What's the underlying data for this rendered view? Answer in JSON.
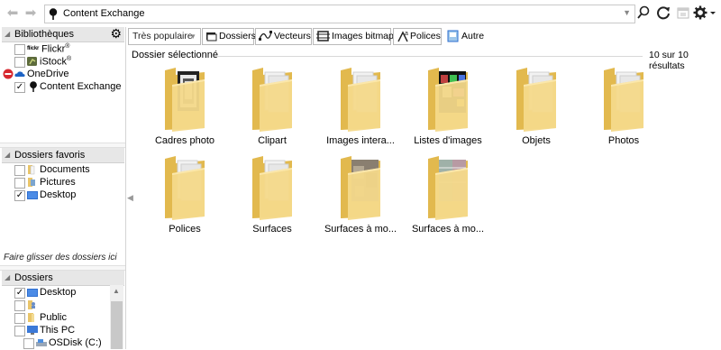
{
  "address": {
    "path": "Content Exchange"
  },
  "libraries": {
    "title": "Bibliothèques",
    "items": [
      {
        "label": "Flickr",
        "mark": "®",
        "brand": "flickr",
        "checked": "",
        "icon": "flickr-icon"
      },
      {
        "label": "iStock",
        "mark": "®",
        "checked": "",
        "icon": "istock-icon"
      },
      {
        "label": "OneDrive",
        "checked": "",
        "icon": "onedrive-icon"
      },
      {
        "label": "Content Exchange",
        "checked": "✓",
        "icon": "pin-icon"
      }
    ]
  },
  "favorites": {
    "title": "Dossiers favoris",
    "items": [
      {
        "label": "Documents",
        "checked": ""
      },
      {
        "label": "Pictures",
        "checked": ""
      },
      {
        "label": "Desktop",
        "checked": "✓"
      }
    ],
    "hint": "Faire glisser des dossiers ici"
  },
  "folders": {
    "title": "Dossiers",
    "items": [
      {
        "label": "Desktop",
        "checked": "✓"
      },
      {
        "label": "",
        "checked": ""
      },
      {
        "label": "Public",
        "checked": ""
      },
      {
        "label": "This PC",
        "checked": ""
      },
      {
        "label": "OSDisk (C:)",
        "checked": ""
      }
    ]
  },
  "toolbar": {
    "sort": "Très populaire",
    "buttons": [
      "Dossiers",
      "Vecteurs",
      "Images bitmap",
      "Polices",
      "Autre"
    ]
  },
  "main": {
    "section_label": "Dossier sélectionné",
    "results": "10 sur 10 résultats",
    "items": [
      {
        "label": "Cadres photo",
        "preview": "frames"
      },
      {
        "label": "Clipart",
        "preview": "none"
      },
      {
        "label": "Images intera...",
        "preview": "none"
      },
      {
        "label": "Listes d'images",
        "preview": "lists"
      },
      {
        "label": "Objets",
        "preview": "none"
      },
      {
        "label": "Photos",
        "preview": "none"
      },
      {
        "label": "Polices",
        "preview": "none"
      },
      {
        "label": "Surfaces",
        "preview": "none"
      },
      {
        "label": "Surfaces à mo...",
        "preview": "stone"
      },
      {
        "label": "Surfaces à mo...",
        "preview": "fabric"
      }
    ]
  },
  "colors": {
    "folder": "#f4d98a",
    "folder_dark": "#e2b94e",
    "accent": "#1f6fd6"
  }
}
